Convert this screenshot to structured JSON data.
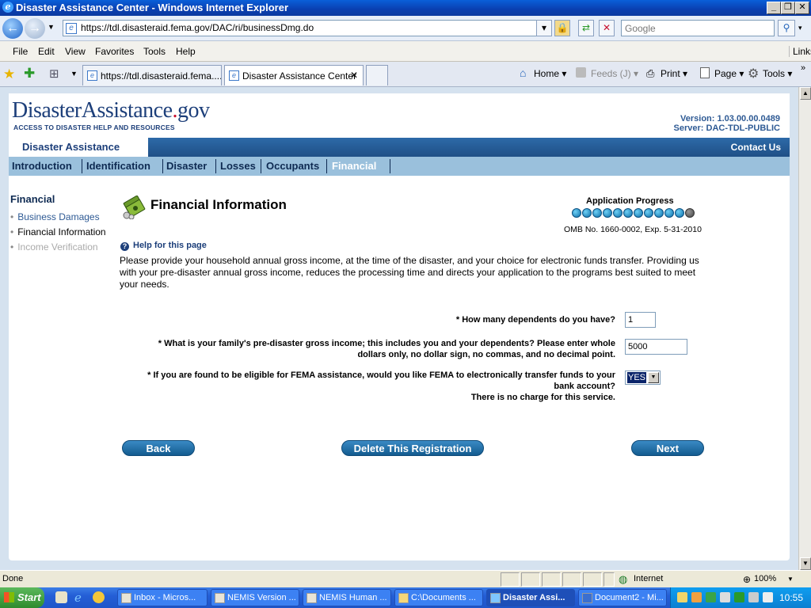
{
  "window": {
    "title": "Disaster Assistance Center - Windows Internet Explorer"
  },
  "address": {
    "url": "https://tdl.disasteraid.fema.gov/DAC/ri/businessDmg.do",
    "search_placeholder": "Google"
  },
  "menu": {
    "items": [
      "File",
      "Edit",
      "View",
      "Favorites",
      "Tools",
      "Help"
    ],
    "links": "Links"
  },
  "tabs": [
    {
      "label": "https://tdl.disasteraid.fema...."
    },
    {
      "label": "Disaster Assistance Center"
    }
  ],
  "commands": {
    "home": "Home",
    "feeds": "Feeds (J)",
    "print": "Print",
    "page": "Page",
    "tools": "Tools"
  },
  "site": {
    "logo_main": "DisasterAssistance",
    "logo_dot": ".",
    "logo_gov": "gov",
    "tagline": "ACCESS TO DISASTER HELP AND RESOURCES",
    "version": "Version: 1.03.00.00.0489",
    "server": "Server: DAC-TDL-PUBLIC",
    "name": "Disaster Assistance",
    "contact": "Contact Us"
  },
  "nav": {
    "items": [
      "Introduction",
      "Identification",
      "Disaster",
      "Losses",
      "Occupants",
      "Financial"
    ],
    "current": "Financial"
  },
  "sidebar": {
    "title": "Financial",
    "items": [
      {
        "label": "Business Damages",
        "state": "link"
      },
      {
        "label": "Financial Information",
        "state": "current"
      },
      {
        "label": "Income Verification",
        "state": "disabled"
      }
    ]
  },
  "main": {
    "title": "Financial Information",
    "progress_title": "Application Progress",
    "progress": {
      "completed": 11,
      "total": 12
    },
    "omb": "OMB No. 1660-0002, Exp. 5-31-2010",
    "help": "Help for this page",
    "intro": "Please provide your household annual gross income, at the time of the disaster, and your choice for electronic funds transfer. Providing us with your pre-disaster annual gross income, reduces the processing time and directs your application to the programs best suited to meet your needs."
  },
  "form": {
    "q1": "* How many dependents do you have?",
    "q1_value": "1",
    "q2_line1": "* What is your family's pre-disaster gross income; this includes you and your dependents? Please enter whole",
    "q2_line2": "dollars only, no dollar sign, no commas, and no decimal point.",
    "q2_value": "5000",
    "q3_line1": "* If you are found to be eligible for FEMA assistance, would you like FEMA to electronically transfer funds to your",
    "q3_line2": "bank account?",
    "q3_line3": "There is no charge for this service.",
    "q3_value": "YES"
  },
  "buttons": {
    "back": "Back",
    "delete": "Delete This Registration",
    "next": "Next"
  },
  "status": {
    "text": "Done",
    "zone": "Internet",
    "zoom": "100%"
  },
  "taskbar": {
    "start": "Start",
    "items": [
      "Inbox - Micros...",
      "NEMIS Version ...",
      "NEMIS Human ...",
      "C:\\Documents ...",
      "Disaster Assi...",
      "Document2 - Mi..."
    ],
    "clock": "10:55"
  }
}
